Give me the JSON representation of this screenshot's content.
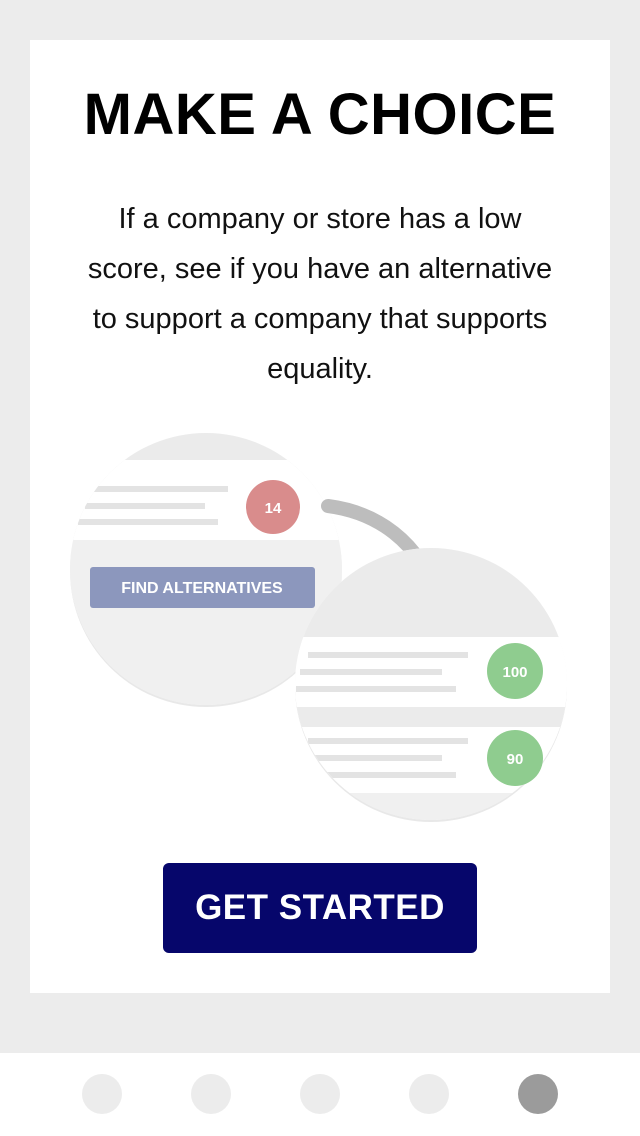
{
  "onboarding": {
    "title": "MAKE A CHOICE",
    "body": "If a company or store has a low score, see if you have an alternative to support a company that supports equality.",
    "cta_label": "GET STARTED"
  },
  "illustration": {
    "low_score": "14",
    "find_alternatives_label": "FIND ALTERNATIVES",
    "alt_scores": [
      "100",
      "90"
    ],
    "colors": {
      "low_score": "#d98c8c",
      "high_score": "#8fcc8f",
      "find_button": "#8c97bd",
      "placeholder_lines": "#e3e3e3",
      "arrow": "#bdbdbd"
    }
  },
  "pager": {
    "page_count": 5,
    "active_index": 4
  },
  "colors": {
    "background": "#ececec",
    "card": "#ffffff",
    "cta": "#06066b",
    "dot_inactive": "#ececec",
    "dot_active": "#9b9b9b"
  }
}
